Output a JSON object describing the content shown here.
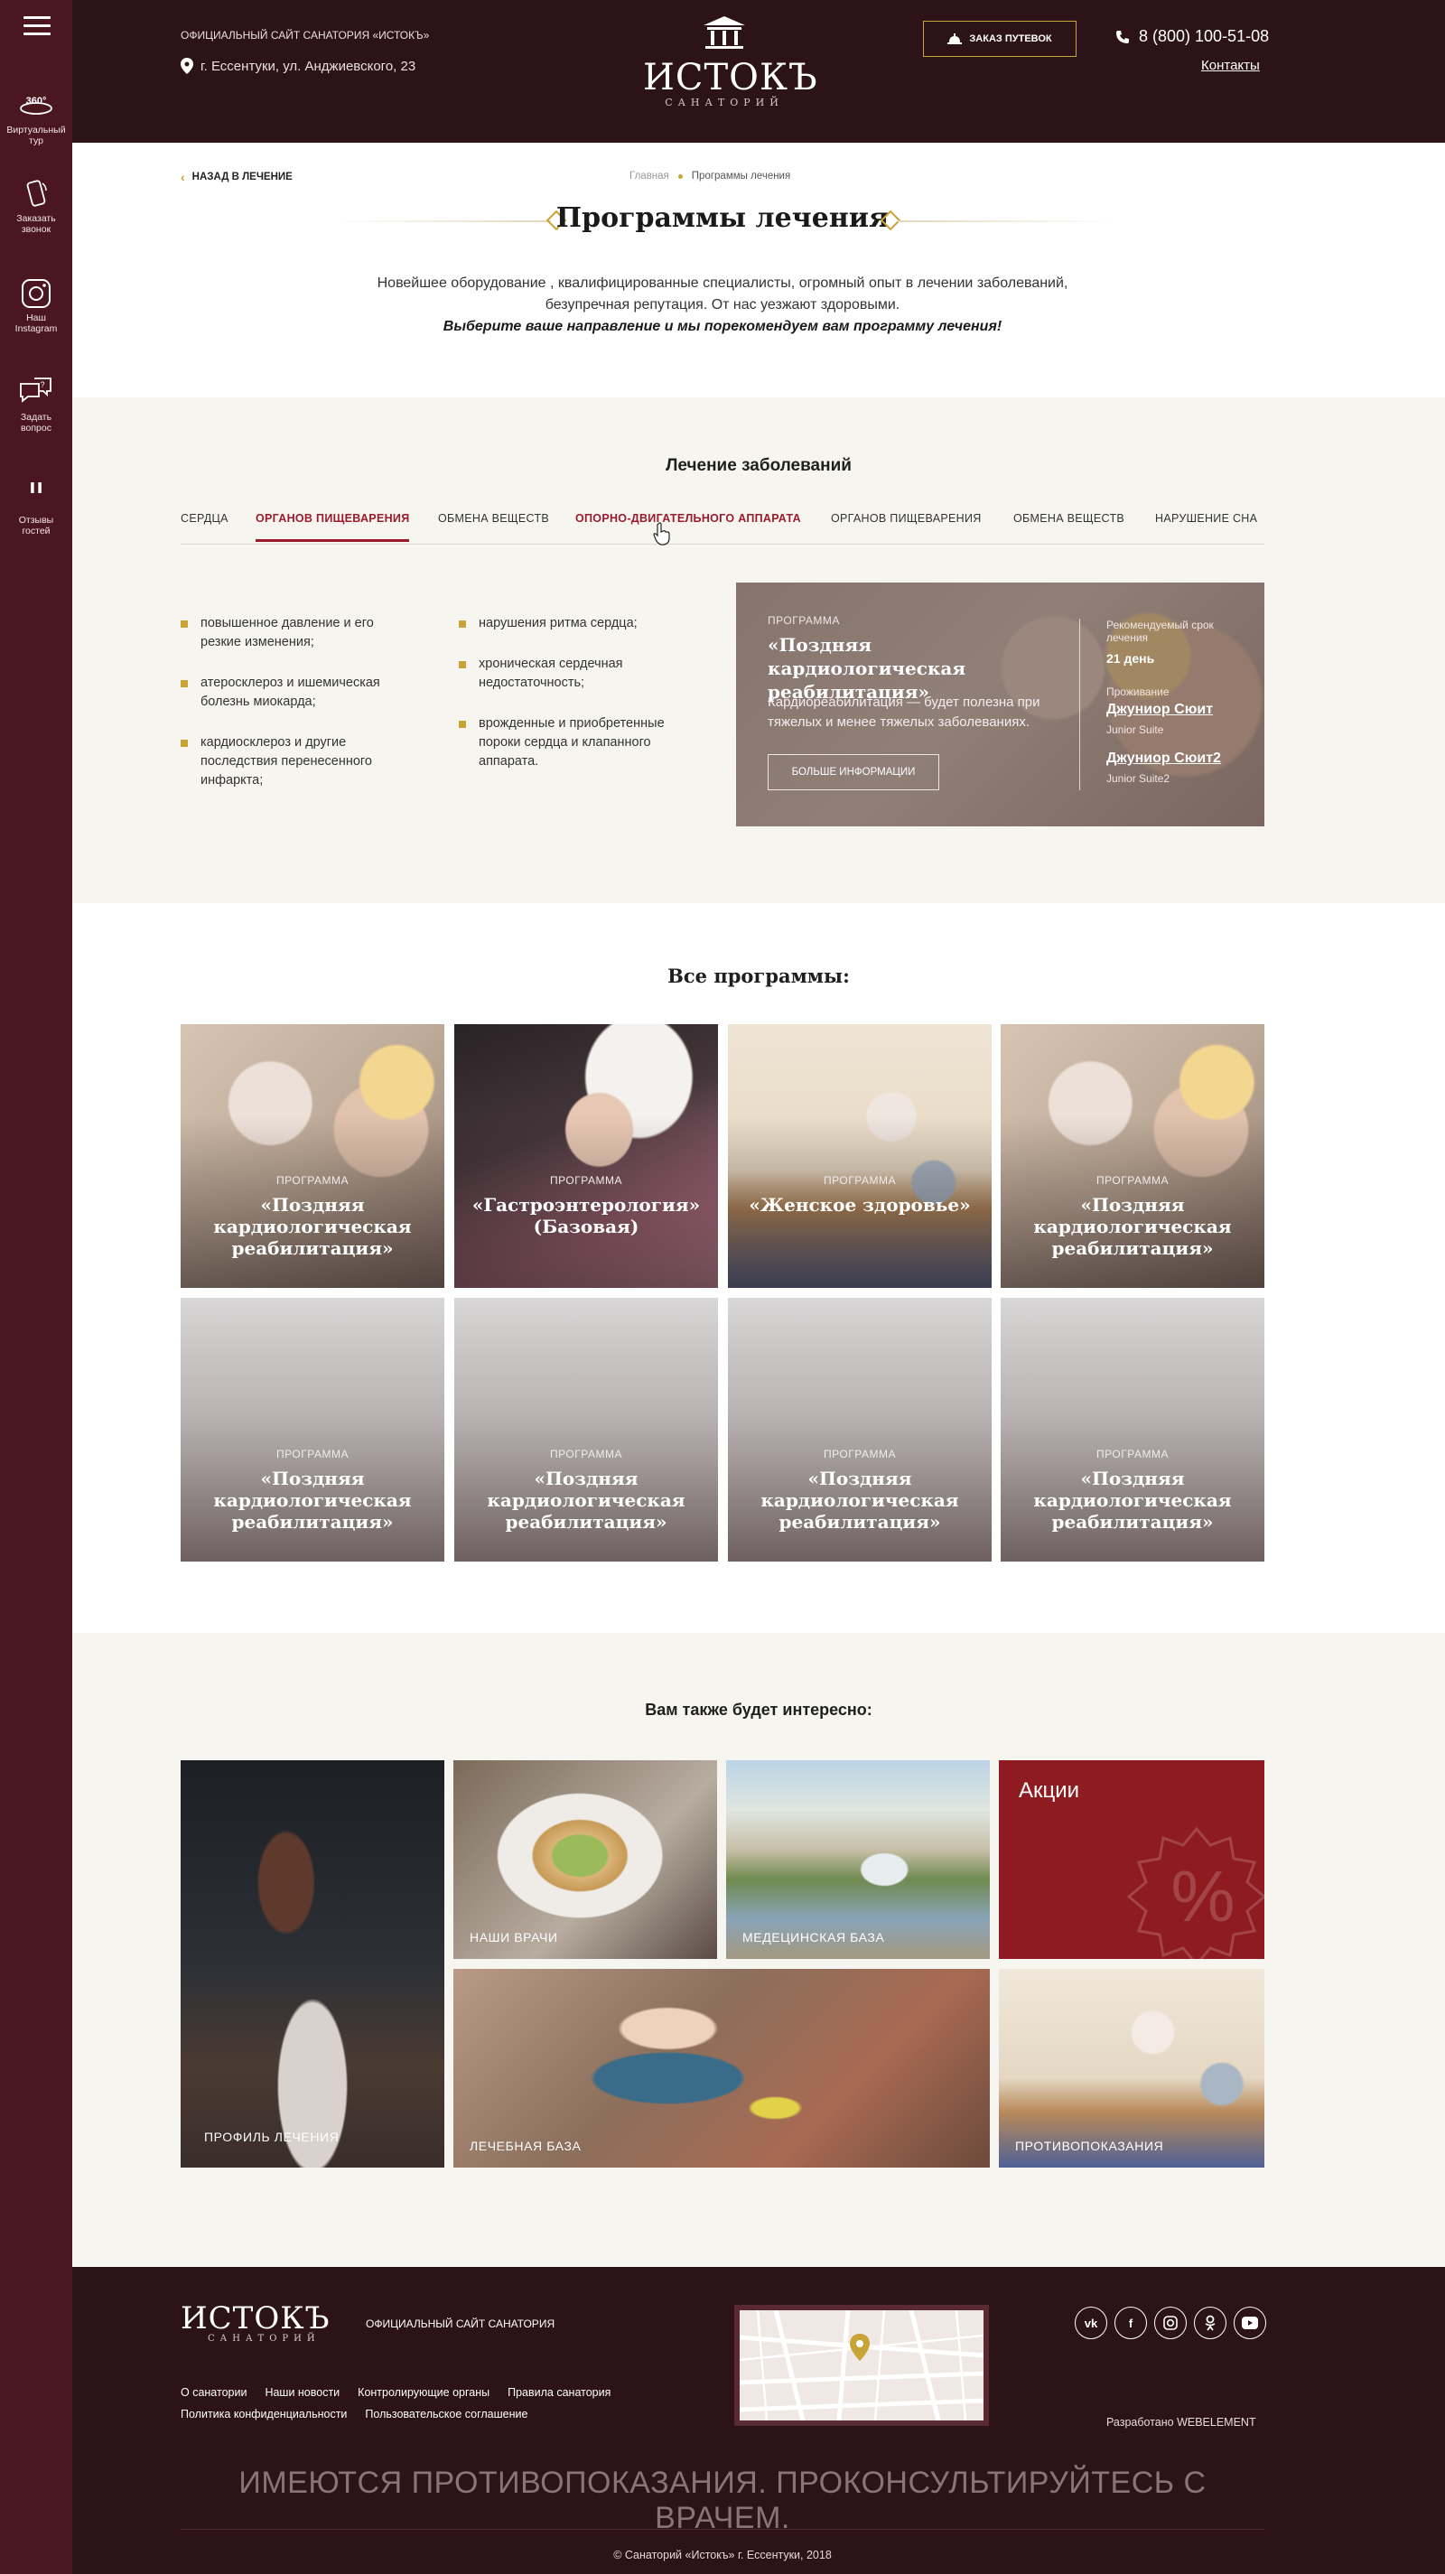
{
  "sidebar": {
    "items": [
      {
        "icon": "panorama-360-icon",
        "label": "Виртуальный тур",
        "badge": "360°"
      },
      {
        "icon": "phone-callback-icon",
        "label": "Заказать звонок"
      },
      {
        "icon": "instagram-icon",
        "label": "Наш Instagram"
      },
      {
        "icon": "question-chat-icon",
        "label": "Задать вопрос"
      },
      {
        "icon": "quote-icon",
        "label": "Отзывы гостей"
      }
    ]
  },
  "header": {
    "official": "ОФИЦИАЛЬНЫЙ САЙТ САНАТОРИЯ «ИСТОКЪ»",
    "address": "г. Ессентуки, ул. Анджиевского, 23",
    "logo_name": "ИСТОКЪ",
    "logo_sub": "САНАТОРИЙ",
    "order_button": "ЗАКАЗ ПУТЕВОК",
    "phone": "8 (800) 100-51-08",
    "contacts": "Контакты",
    "colors": {
      "bg": "#2c1318",
      "accent": "#c8a437"
    }
  },
  "page": {
    "back_link": "НАЗАД В ЛЕЧЕНИЕ",
    "breadcrumbs": [
      "Главная",
      "Программы лечения"
    ],
    "title": "Программы лечения",
    "intro": "Новейшее оборудование , квалифицированные специалисты, огромный опыт в лечении заболеваний, безупречная репутация. От нас уезжают здоровыми.",
    "intro_emphasis": "Выберите ваше направление и мы порекомендуем вам программу лечения!"
  },
  "diseases": {
    "title": "Лечение заболеваний",
    "tabs": [
      "СЕРДЦА",
      "ОРГАНОВ ПИЩЕВАРЕНИЯ",
      "ОБМЕНА ВЕЩЕСТВ",
      "ОПОРНО-ДВИГАТЕЛЬНОГО АППАРАТА",
      "ОРГАНОВ ПИЩЕВАРЕНИЯ",
      "ОБМЕНА ВЕЩЕСТВ",
      "НАРУШЕНИЕ СНА"
    ],
    "active_tab": "ОРГАНОВ ПИЩЕВАРЕНИЯ",
    "list_left": [
      "повышенное давление и его резкие изменения;",
      "атеросклероз и ишемическая болезнь миокарда;",
      "кардиосклероз и другие последствия перенесенного инфаркта;"
    ],
    "list_right": [
      "нарушения ритма сердца;",
      "хроническая сердечная недостаточность;",
      "врожденные и приобретенные пороки сердца и клапанного аппарата."
    ],
    "program": {
      "label": "ПРОГРАММА",
      "title": "«Поздняя кардиологическая реабилитация»",
      "desc": "Кардиореабилитация — будет полезна при тяжелых и менее тяжелых заболеваниях.",
      "button": "БОЛЬШЕ ИНФОРМАЦИИ",
      "term_label": "Рекомендуемый срок лечения",
      "term_value": "21 день",
      "stay_label": "Проживание",
      "room1": "Джуниор Сюит",
      "room1_en": "Junior Suite",
      "room2": "Джуниор Сюит2",
      "room2_en": "Junior Suite2"
    }
  },
  "all_programs": {
    "title": "Все программы:",
    "cards": [
      {
        "label": "ПРОГРАММА",
        "title": "«Поздняя кардиологическая реабилитация»",
        "image": "elderly-couple-photo"
      },
      {
        "label": "ПРОГРАММА",
        "title": "«Гастроэнтерология» (Базовая)",
        "image": "massage-photo"
      },
      {
        "label": "ПРОГРАММА",
        "title": "«Женское здоровье»",
        "image": "yoga-photo"
      },
      {
        "label": "ПРОГРАММА",
        "title": "«Поздняя кардиологическая реабилитация»",
        "image": "elderly-couple-photo"
      },
      {
        "label": "ПРОГРАММА",
        "title": "«Поздняя кардиологическая реабилитация»",
        "image": "placeholder-gradient"
      },
      {
        "label": "ПРОГРАММА",
        "title": "«Поздняя кардиологическая реабилитация»",
        "image": "placeholder-gradient"
      },
      {
        "label": "ПРОГРАММА",
        "title": "«Поздняя кардиологическая реабилитация»",
        "image": "placeholder-gradient"
      },
      {
        "label": "ПРОГРАММА",
        "title": "«Поздняя кардиологическая реабилитация»",
        "image": "placeholder-gradient"
      }
    ]
  },
  "interesting": {
    "title": "Вам также будет интересно:",
    "cards": [
      {
        "label": "ПРОФИЛЬ ЛЕЧЕНИЯ",
        "image": "sauna-room-photo"
      },
      {
        "label": "НАШИ ВРАЧИ",
        "image": "food-plate-photo"
      },
      {
        "label": "МЕДЕЦИНСКАЯ БАЗА",
        "image": "fountain-building-photo"
      },
      {
        "label": "Акции",
        "image": "percent-badge"
      },
      {
        "label": "ЛЕЧЕБНАЯ БАЗА",
        "image": "child-playing-photo"
      },
      {
        "label": "ПРОТИВОПОКАЗАНИЯ",
        "image": "yoga-photo"
      }
    ]
  },
  "footer": {
    "logo_name": "ИСТОКЪ",
    "logo_sub": "САНАТОРИЙ",
    "official": "ОФИЦИАЛЬНЫЙ САЙТ САНАТОРИЯ",
    "links_row1": [
      "О санатории",
      "Наши новости",
      "Контролирующие органы",
      "Правила санатория"
    ],
    "links_row2": [
      "Политика конфиденциальности",
      "Пользовательское соглашение"
    ],
    "socials": [
      "vk-icon",
      "facebook-icon",
      "instagram-icon",
      "odnoklassniki-icon",
      "youtube-icon"
    ],
    "developer": "Разработано WEBELEMENT",
    "warning": "ИМЕЮТСЯ ПРОТИВОПОКАЗАНИЯ. ПРОКОНСУЛЬТИРУЙТЕСЬ С ВРАЧЕМ.",
    "copyright": "© Санаторий «Истокъ» г. Ессентуки, 2018"
  }
}
